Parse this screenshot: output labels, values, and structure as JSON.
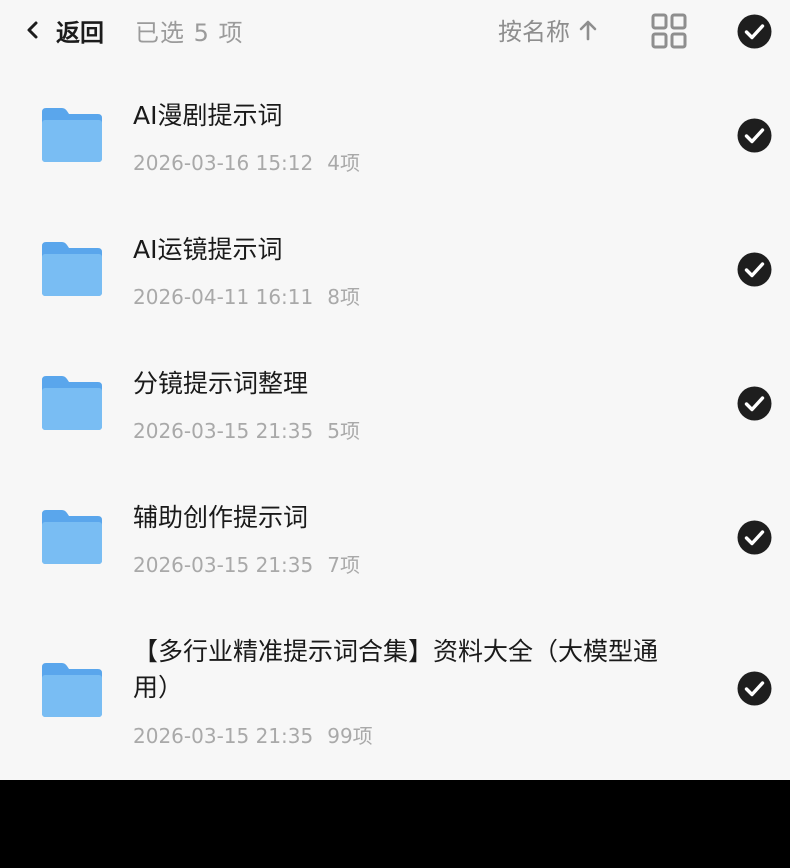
{
  "header": {
    "back_label": "返回",
    "selected_text": "已选 5 项",
    "sort_label": "按名称"
  },
  "colors": {
    "background": "#f7f7f7",
    "title_text": "#1a1a1a",
    "meta_text": "#a9a9a9",
    "check_fill": "#1e1e1e",
    "folder_blue": "#6cb3f0"
  },
  "items": [
    {
      "name": "AI漫剧提示词",
      "date": "2026-03-16 15:12",
      "count": "4项",
      "selected": true
    },
    {
      "name": "AI运镜提示词",
      "date": "2026-04-11 16:11",
      "count": "8项",
      "selected": true
    },
    {
      "name": "分镜提示词整理",
      "date": "2026-03-15 21:35",
      "count": "5项",
      "selected": true
    },
    {
      "name": "辅助创作提示词",
      "date": "2026-03-15 21:35",
      "count": "7项",
      "selected": true
    },
    {
      "name": "【多行业精准提示词合集】资料大全（大模型通用）",
      "date": "2026-03-15 21:35",
      "count": "99项",
      "selected": true
    }
  ]
}
